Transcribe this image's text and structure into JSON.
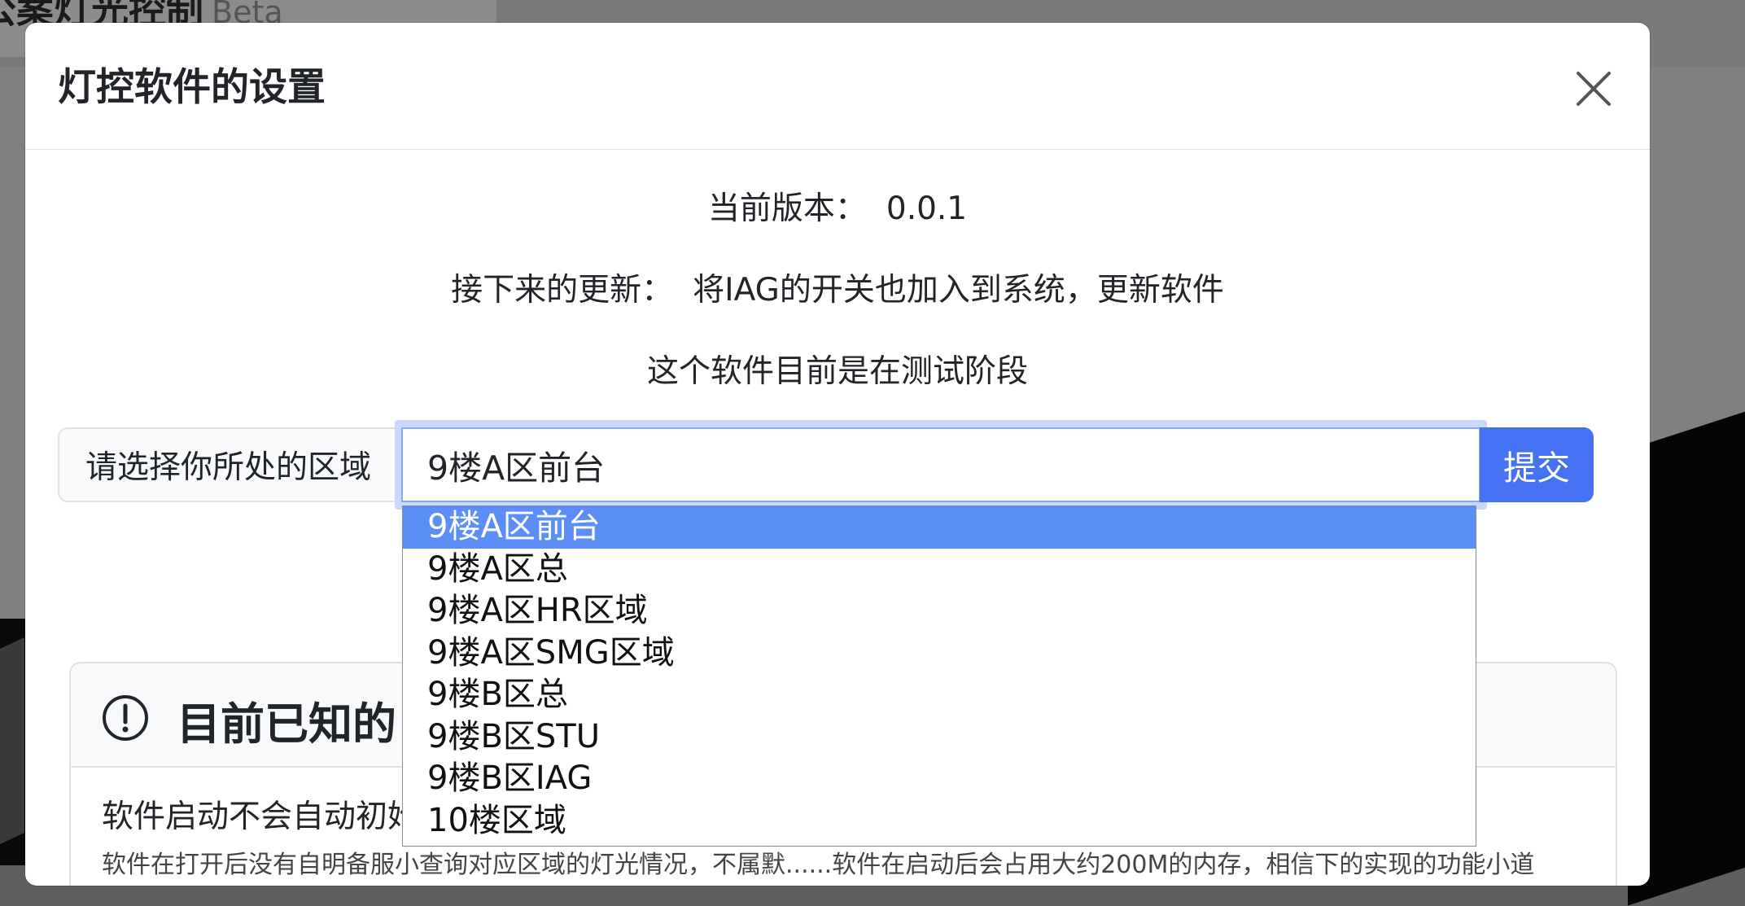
{
  "background": {
    "app_title": "公案灯光控制",
    "app_badge": "Beta"
  },
  "modal": {
    "title": "灯控软件的设置",
    "close_icon": "close-icon",
    "version_label": "当前版本：",
    "version_value": "0.0.1",
    "next_update_label": "接下来的更新：",
    "next_update_value": "将IAG的开关也加入到系统，更新软件",
    "test_stage_note": "这个软件目前是在测试阶段",
    "region_label": "请选择你所处的区域",
    "region_selected": "9楼A区前台",
    "submit_label": "提交",
    "region_options": [
      {
        "label": "9楼A区前台",
        "selected": true
      },
      {
        "label": "9楼A区总",
        "selected": false
      },
      {
        "label": "9楼A区HR区域",
        "selected": false
      },
      {
        "label": "9楼A区SMG区域",
        "selected": false
      },
      {
        "label": "9楼B区总",
        "selected": false
      },
      {
        "label": "9楼B区STU",
        "selected": false
      },
      {
        "label": "9楼B区IAG",
        "selected": false
      },
      {
        "label": "10楼区域",
        "selected": false
      }
    ],
    "known_issues": {
      "icon": "exclamation-circle-icon",
      "title": "目前已知的",
      "line1": "软件启动不会自动初始",
      "line2": "软件在打开后没有自明备服小查询对应区域的灯光情况，不属默......软件在启动后会占用大约200M的内存，相信下的实现的功能小道"
    }
  },
  "colors": {
    "primary": "#4472f2",
    "dropdown_highlight": "#5b8ef7",
    "focus_ring": "#c9d8fc"
  }
}
